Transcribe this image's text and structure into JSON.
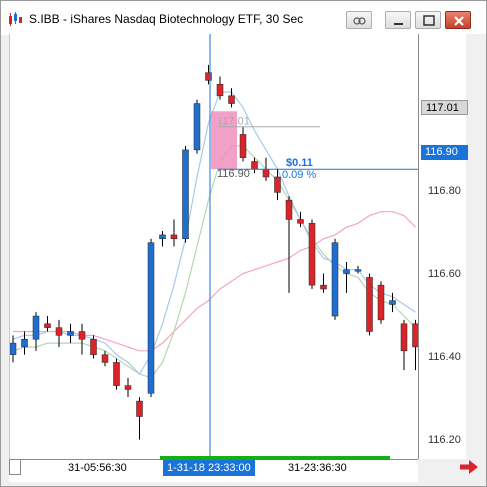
{
  "window": {
    "title": "S.IBB - iShares Nasdaq Biotechnology ETF, 30 Sec",
    "icon": "candlestick-chart-icon",
    "buttons": [
      "link-icon",
      "minimize-icon",
      "maximize-icon",
      "close-icon"
    ]
  },
  "price_axis": {
    "labels": [
      "116.80",
      "116.60",
      "116.40",
      "116.20"
    ],
    "current_price": "117.01",
    "crosshair_price": "116.90"
  },
  "time_axis": {
    "labels": [
      "31-05:56:30",
      "31-23:36:30"
    ],
    "crosshair_time": "1-31-18 23:33:00"
  },
  "measure": {
    "price_label": "117.01",
    "low_label": "116.90",
    "change": "$0.11",
    "change_pct": "0.09 %"
  },
  "colors": {
    "up": "#1e6fd0",
    "down": "#d9242a",
    "crosshair": "#1a73d9",
    "ma_fast": "#a9c8ec",
    "ma_medium": "#b6d6b0",
    "ma_slow": "#f2a6c6",
    "highlight": "#f08fbe"
  },
  "chart_data": {
    "type": "candlestick",
    "ylim": [
      116.15,
      117.25
    ],
    "ticks": [
      116.2,
      116.4,
      116.6,
      116.8
    ],
    "candles": [
      {
        "o": 116.42,
        "h": 116.47,
        "l": 116.4,
        "c": 116.45
      },
      {
        "o": 116.44,
        "h": 116.48,
        "l": 116.42,
        "c": 116.46
      },
      {
        "o": 116.46,
        "h": 116.53,
        "l": 116.43,
        "c": 116.52
      },
      {
        "o": 116.5,
        "h": 116.52,
        "l": 116.48,
        "c": 116.49
      },
      {
        "o": 116.49,
        "h": 116.51,
        "l": 116.44,
        "c": 116.47
      },
      {
        "o": 116.47,
        "h": 116.5,
        "l": 116.45,
        "c": 116.48
      },
      {
        "o": 116.48,
        "h": 116.5,
        "l": 116.42,
        "c": 116.46
      },
      {
        "o": 116.46,
        "h": 116.47,
        "l": 116.41,
        "c": 116.42
      },
      {
        "o": 116.42,
        "h": 116.43,
        "l": 116.39,
        "c": 116.4
      },
      {
        "o": 116.4,
        "h": 116.41,
        "l": 116.33,
        "c": 116.34
      },
      {
        "o": 116.34,
        "h": 116.36,
        "l": 116.31,
        "c": 116.33
      },
      {
        "o": 116.3,
        "h": 116.31,
        "l": 116.2,
        "c": 116.26
      },
      {
        "o": 116.32,
        "h": 116.72,
        "l": 116.31,
        "c": 116.71
      },
      {
        "o": 116.72,
        "h": 116.74,
        "l": 116.7,
        "c": 116.73
      },
      {
        "o": 116.73,
        "h": 116.77,
        "l": 116.7,
        "c": 116.72
      },
      {
        "o": 116.72,
        "h": 116.96,
        "l": 116.71,
        "c": 116.95
      },
      {
        "o": 116.95,
        "h": 117.08,
        "l": 116.94,
        "c": 117.07
      },
      {
        "o": 117.15,
        "h": 117.17,
        "l": 117.12,
        "c": 117.13
      },
      {
        "o": 117.12,
        "h": 117.14,
        "l": 117.08,
        "c": 117.09
      },
      {
        "o": 117.09,
        "h": 117.11,
        "l": 117.06,
        "c": 117.07
      },
      {
        "o": 116.99,
        "h": 117.01,
        "l": 116.92,
        "c": 116.93
      },
      {
        "o": 116.92,
        "h": 116.93,
        "l": 116.89,
        "c": 116.9
      },
      {
        "o": 116.9,
        "h": 116.93,
        "l": 116.87,
        "c": 116.88
      },
      {
        "o": 116.88,
        "h": 116.9,
        "l": 116.82,
        "c": 116.84
      },
      {
        "o": 116.82,
        "h": 116.83,
        "l": 116.58,
        "c": 116.77
      },
      {
        "o": 116.77,
        "h": 116.79,
        "l": 116.75,
        "c": 116.76
      },
      {
        "o": 116.76,
        "h": 116.77,
        "l": 116.59,
        "c": 116.6
      },
      {
        "o": 116.6,
        "h": 116.63,
        "l": 116.58,
        "c": 116.59
      },
      {
        "o": 116.52,
        "h": 116.72,
        "l": 116.51,
        "c": 116.71
      },
      {
        "o": 116.63,
        "h": 116.66,
        "l": 116.58,
        "c": 116.64
      },
      {
        "o": 116.64,
        "h": 116.65,
        "l": 116.63,
        "c": 116.64
      },
      {
        "o": 116.62,
        "h": 116.63,
        "l": 116.47,
        "c": 116.48
      },
      {
        "o": 116.6,
        "h": 116.61,
        "l": 116.5,
        "c": 116.51
      },
      {
        "o": 116.55,
        "h": 116.58,
        "l": 116.53,
        "c": 116.56
      },
      {
        "o": 116.5,
        "h": 116.51,
        "l": 116.38,
        "c": 116.43
      },
      {
        "o": 116.5,
        "h": 116.51,
        "l": 116.38,
        "c": 116.44
      }
    ],
    "ma_fast": [
      116.46,
      116.47,
      116.47,
      116.48,
      116.48,
      116.47,
      116.47,
      116.46,
      116.45,
      116.42,
      116.4,
      116.37,
      116.42,
      116.5,
      116.6,
      116.72,
      116.88,
      117.02,
      117.1,
      117.1,
      117.06,
      117.0,
      116.95,
      116.9,
      116.83,
      116.77,
      116.71,
      116.67,
      116.66,
      116.64,
      116.64,
      116.6,
      116.58,
      116.57,
      116.55,
      116.53
    ],
    "ma_medium": [
      116.43,
      116.44,
      116.44,
      116.45,
      116.45,
      116.45,
      116.45,
      116.44,
      116.43,
      116.41,
      116.39,
      116.37,
      116.36,
      116.4,
      116.48,
      116.58,
      116.7,
      116.82,
      116.92,
      116.96,
      116.96,
      116.93,
      116.9,
      116.87,
      116.82,
      116.77,
      116.72,
      116.68,
      116.65,
      116.63,
      116.62,
      116.58,
      116.56,
      116.55,
      116.52,
      116.49
    ],
    "ma_slow": [
      116.48,
      116.48,
      116.48,
      116.48,
      116.48,
      116.48,
      116.47,
      116.47,
      116.46,
      116.45,
      116.44,
      116.43,
      116.43,
      116.45,
      116.48,
      116.51,
      116.54,
      116.56,
      116.59,
      116.61,
      116.63,
      116.64,
      116.65,
      116.66,
      116.67,
      116.69,
      116.7,
      116.72,
      116.73,
      116.75,
      116.76,
      116.78,
      116.79,
      116.79,
      116.78,
      116.75
    ]
  }
}
